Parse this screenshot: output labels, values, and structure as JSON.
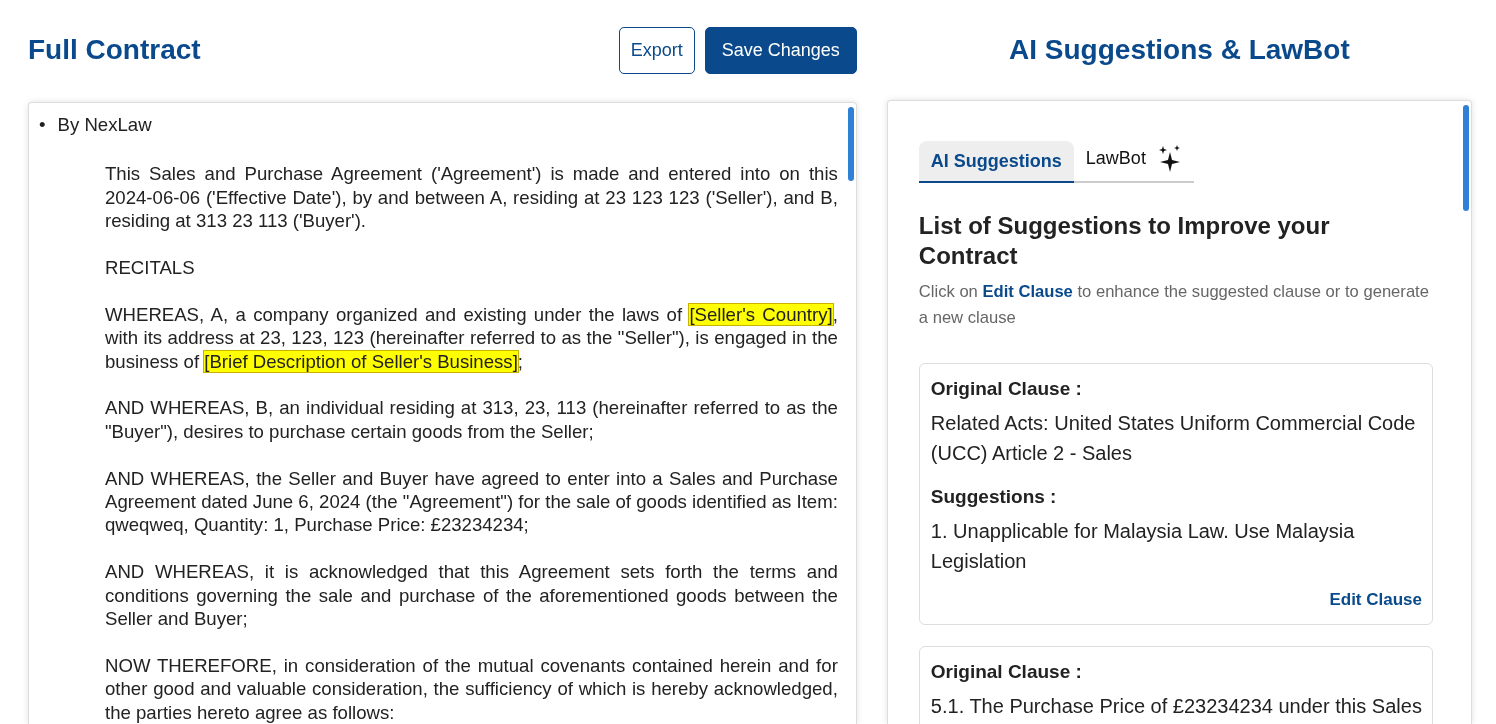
{
  "contract": {
    "title": "Full Contract",
    "buttons": [
      {
        "label": "Export",
        "kind": "outline"
      },
      {
        "label": "Save Changes",
        "kind": "primary"
      }
    ],
    "bullet_mark": "•",
    "bullet": "By NexLaw",
    "paragraphs": [
      [
        {
          "text": "This Sales and Purchase Agreement ('Agreement') is made and entered into on this 2024-06-06 ('Effective Date'), by and between A, residing at 23 123 123 ('Seller'), and B, residing at 313 23 113 ('Buyer').",
          "highlighted": false
        }
      ],
      [
        {
          "text": "RECITALS",
          "highlighted": false
        }
      ],
      [
        {
          "text": "WHEREAS, A, a company organized and existing under the laws of ",
          "highlighted": false
        },
        {
          "text": "[Seller's Country]",
          "highlighted": true
        },
        {
          "text": ", with its address at 23, 123, 123 (hereinafter referred to as the \"Seller\"), is engaged in the business of ",
          "highlighted": false
        },
        {
          "text": "[Brief Description of Seller's Business]",
          "highlighted": true
        },
        {
          "text": ";",
          "highlighted": false
        }
      ],
      [
        {
          "text": "AND WHEREAS, B, an individual residing at 313, 23, 113 (hereinafter referred to as the \"Buyer\"), desires to purchase certain goods from the Seller;",
          "highlighted": false
        }
      ],
      [
        {
          "text": "AND WHEREAS, the Seller and Buyer have agreed to enter into a Sales and Purchase Agreement dated June 6, 2024 (the \"Agreement\") for the sale of goods identified as Item: qweqweq, Quantity: 1, Purchase Price: £23234234;",
          "highlighted": false
        }
      ],
      [
        {
          "text": "AND WHEREAS, it is acknowledged that this Agreement sets forth the terms and conditions governing the sale and purchase of the aforementioned goods between the Seller and Buyer;",
          "highlighted": false
        }
      ],
      [
        {
          "text": "NOW THEREFORE, in consideration of the mutual covenants contained herein and for other good and valuable consideration, the sufficiency of which is hereby acknowledged, the parties hereto agree as follows:",
          "highlighted": false
        }
      ]
    ]
  },
  "assistant": {
    "title": "AI Suggestions & LawBot",
    "tabs": [
      {
        "label": "AI Suggestions",
        "selected": true
      },
      {
        "label": "LawBot",
        "selected": false
      }
    ],
    "heading": "List of Suggestions to Improve your Contract",
    "instruction": "Click on **Edit Clause** to enhance the suggested clause or to generate a new clause",
    "cards": [
      {
        "original_label": "Original Clause :",
        "original": "Related Acts: United States Uniform Commercial Code (UCC) Article 2 - Sales",
        "suggestions_label": "Suggestions :",
        "suggestions": [
          "1. Unapplicable for Malaysia Law. Use Malaysia Legislation"
        ],
        "action": "Edit Clause"
      },
      {
        "original_label": "Original Clause :",
        "original": "5.1. The Purchase Price of £23234234 under this Sales"
      }
    ]
  }
}
